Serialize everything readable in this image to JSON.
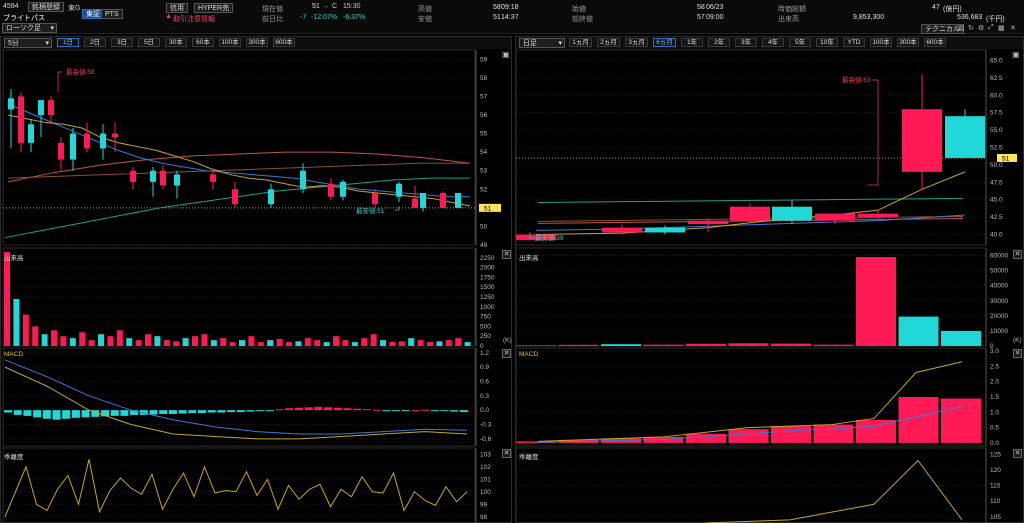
{
  "header": {
    "code": "4594",
    "name": "ブライトパス",
    "register_btn": "銘柄登録",
    "market": "東G",
    "exch_tse": "東証",
    "exch_pts": "PTS",
    "market_select": "ローソク足",
    "credit_badge": "信用",
    "hyper_badge": "HYPER売",
    "warning_text": "取引注意情報",
    "current_label": "現在値",
    "current_value": "51",
    "current_arrow": "→",
    "current_flag": "C",
    "current_time": "15:30",
    "change_label": "前日比",
    "change_value": "-7",
    "change_pct": "-12.07%",
    "change_pct2": "-6.37%",
    "high_label": "高値",
    "high_value": "58",
    "high_time": "09:18",
    "low_label": "安値",
    "low_value": "51",
    "low_time": "14:37",
    "open_label": "始値",
    "open_value": "58",
    "open_date": "06/23",
    "prevclose_label": "前終値",
    "prevclose_value": "57",
    "prevclose_time": "09:00",
    "prevdiff_label": "陽値",
    "mcap_label": "時価総額",
    "mcap_value": "47",
    "mcap_unit": "(億円)",
    "volume_label": "出来高",
    "volume_value": "9,853,300",
    "turnover_value": "536,683",
    "turnover_unit": "(千円)",
    "technical_btn": "テクニカル"
  },
  "left": {
    "interval_select": "5分",
    "tabs": [
      "1日",
      "2日",
      "3日",
      "5日",
      "30本",
      "60本",
      "100本",
      "300本",
      "600本"
    ],
    "active_tab": "1日",
    "price_high_label": "最高値:58",
    "price_low_label": "最安値:51",
    "price_axis": [
      "59",
      "58",
      "57",
      "56",
      "55",
      "54",
      "53",
      "52",
      "51",
      "50",
      "49"
    ],
    "last_price": "51",
    "volume_title": "出来高",
    "volume_axis": [
      "2500",
      "2250",
      "2000",
      "1750",
      "1500",
      "1250",
      "1000",
      "750",
      "500",
      "250",
      "0"
    ],
    "volume_unit": "(K)",
    "macd_title": "MACD",
    "macd_axis": [
      "1.2",
      "0.9",
      "0.6",
      "0.3",
      "0.0",
      "-0.3",
      "-0.6"
    ],
    "kairi_title": "乖離度",
    "kairi_axis": [
      "103",
      "102",
      "101",
      "100",
      "99",
      "98"
    ]
  },
  "right": {
    "interval_select": "日足",
    "tabs": [
      "1ヵ月",
      "2ヵ月",
      "3ヵ月",
      "6ヵ月",
      "1年",
      "2年",
      "3年",
      "4年",
      "5年",
      "10年",
      "YTD",
      "100本",
      "300本",
      "600本"
    ],
    "active_tab": "6ヵ月",
    "price_high_label": "最高値:63",
    "price_low_label": "最安値:39",
    "price_axis": [
      "65.0",
      "62.5",
      "60.0",
      "57.5",
      "55.0",
      "52.5",
      "50.0",
      "47.5",
      "45.0",
      "42.5",
      "40.0"
    ],
    "last_price": "51",
    "volume_title": "出来高",
    "volume_axis": [
      "60000",
      "50000",
      "40000",
      "30000",
      "20000",
      "10000",
      "0"
    ],
    "volume_unit": "(K)",
    "macd_title": "MACD",
    "macd_axis": [
      "3.0",
      "2.5",
      "2.0",
      "1.5",
      "1.0",
      "0.5",
      "0.0"
    ],
    "kairi_title": "乖離度",
    "kairi_axis": [
      "125",
      "120",
      "115",
      "110",
      "105"
    ]
  },
  "chart_data": [
    {
      "type": "candlestick",
      "title": "5分",
      "ylim": [
        49,
        59.5
      ],
      "candles": [
        {
          "o": 56.3,
          "h": 57.4,
          "l": 54.2,
          "c": 56.9,
          "d": "up"
        },
        {
          "o": 57.0,
          "h": 57.2,
          "l": 54.0,
          "c": 54.5,
          "d": "down"
        },
        {
          "o": 54.5,
          "h": 55.8,
          "l": 54.0,
          "c": 55.5,
          "d": "up"
        },
        {
          "o": 56.0,
          "h": 56.8,
          "l": 54.8,
          "c": 56.8,
          "d": "up"
        },
        {
          "o": 56.8,
          "h": 57.0,
          "l": 55.5,
          "c": 56.0,
          "d": "down"
        },
        {
          "o": 54.5,
          "h": 54.8,
          "l": 53.0,
          "c": 53.6,
          "d": "down"
        },
        {
          "o": 53.6,
          "h": 55.3,
          "l": 53.0,
          "c": 55.0,
          "d": "up"
        },
        {
          "o": 55.0,
          "h": 55.6,
          "l": 54.0,
          "c": 54.2,
          "d": "down"
        },
        {
          "o": 54.2,
          "h": 55.5,
          "l": 53.6,
          "c": 55.0,
          "d": "up"
        },
        {
          "o": 55.0,
          "h": 55.6,
          "l": 54.0,
          "c": 54.8,
          "d": "down"
        },
        {
          "o": 53.0,
          "h": 53.2,
          "l": 52.0,
          "c": 52.4,
          "d": "down"
        },
        {
          "o": 52.4,
          "h": 53.2,
          "l": 51.6,
          "c": 53.0,
          "d": "up"
        },
        {
          "o": 53.0,
          "h": 53.3,
          "l": 52.0,
          "c": 52.2,
          "d": "down"
        },
        {
          "o": 52.2,
          "h": 53.0,
          "l": 51.5,
          "c": 52.8,
          "d": "up"
        },
        {
          "o": 52.8,
          "h": 53.0,
          "l": 52.0,
          "c": 52.4,
          "d": "down"
        },
        {
          "o": 52.0,
          "h": 52.4,
          "l": 51.0,
          "c": 51.2,
          "d": "down"
        },
        {
          "o": 51.2,
          "h": 52.3,
          "l": 51.0,
          "c": 52.0,
          "d": "up"
        },
        {
          "o": 52.0,
          "h": 53.4,
          "l": 51.8,
          "c": 53.0,
          "d": "up"
        },
        {
          "o": 52.3,
          "h": 52.6,
          "l": 51.4,
          "c": 51.6,
          "d": "down"
        },
        {
          "o": 51.6,
          "h": 52.5,
          "l": 51.4,
          "c": 52.4,
          "d": "up"
        },
        {
          "o": 51.8,
          "h": 52.0,
          "l": 51.0,
          "c": 51.2,
          "d": "down"
        },
        {
          "o": 51.6,
          "h": 52.4,
          "l": 51.3,
          "c": 52.3,
          "d": "up"
        },
        {
          "o": 51.5,
          "h": 52.2,
          "l": 51.0,
          "c": 51.0,
          "d": "down"
        },
        {
          "o": 51.0,
          "h": 51.8,
          "l": 50.8,
          "c": 51.8,
          "d": "up"
        },
        {
          "o": 51.8,
          "h": 51.9,
          "l": 51.0,
          "c": 51.0,
          "d": "down"
        },
        {
          "o": 51.0,
          "h": 51.8,
          "l": 51.0,
          "c": 51.8,
          "d": "up"
        }
      ],
      "ma_short": [
        56.0,
        55.8,
        55.6,
        55.5,
        55.3,
        54.8,
        54.5,
        54.3,
        54.1,
        53.8,
        53.5,
        53.1,
        52.8,
        52.6,
        52.5,
        52.3,
        52.1,
        52.2,
        52.1,
        51.9,
        51.8,
        51.7,
        51.6,
        51.5,
        51.3,
        51.1
      ],
      "ma_mid": [
        56.6,
        56.1,
        55.6,
        55.1,
        54.6,
        54.1,
        53.7,
        53.4,
        53.2,
        53.0,
        52.9,
        52.8,
        52.7,
        52.6,
        52.4,
        52.2,
        52.0,
        51.9,
        51.8,
        51.7,
        51.6,
        51.6
      ],
      "ma_long1": [
        52.4,
        52.9,
        53.3,
        53.6,
        53.8,
        53.9,
        54.0,
        54.0,
        53.9,
        53.7,
        53.4
      ],
      "ma_long2": [
        52.6,
        52.7,
        52.8,
        52.9,
        53.0,
        53.1,
        53.2,
        53.3,
        53.4,
        53.4
      ],
      "ma_rising": [
        49.4,
        49.8,
        50.2,
        50.6,
        51.0,
        51.3,
        51.6,
        51.9,
        52.1,
        52.3,
        52.5,
        52.6,
        52.6
      ],
      "last": 51
    },
    {
      "type": "candlestick",
      "title": "日足",
      "ylim": [
        38.5,
        66.5
      ],
      "candles": [
        {
          "o": 40.0,
          "h": 40.2,
          "l": 39.0,
          "c": 39.2,
          "d": "down"
        },
        {
          "o": 41.0,
          "h": 41.4,
          "l": 40.0,
          "c": 40.3,
          "d": "down"
        },
        {
          "o": 40.3,
          "h": 41.3,
          "l": 40.0,
          "c": 41.0,
          "d": "up"
        },
        {
          "o": 41.5,
          "h": 42.3,
          "l": 40.4,
          "c": 42.0,
          "d": "down"
        },
        {
          "o": 42.0,
          "h": 44.5,
          "l": 41.8,
          "c": 44.0,
          "d": "down"
        },
        {
          "o": 42.0,
          "h": 45.0,
          "l": 41.5,
          "c": 44.0,
          "d": "up"
        },
        {
          "o": 42.0,
          "h": 43.0,
          "l": 41.5,
          "c": 43.0,
          "d": "down"
        },
        {
          "o": 43.0,
          "h": 43.5,
          "l": 42.0,
          "c": 42.5,
          "d": "down"
        },
        {
          "o": 49.0,
          "h": 63.0,
          "l": 46.5,
          "c": 58.0,
          "d": "down"
        },
        {
          "o": 51.0,
          "h": 58.0,
          "l": 51.0,
          "c": 57.0,
          "d": "up"
        }
      ],
      "ma_yellow": [
        40.0,
        40.2,
        40.6,
        41.0,
        41.7,
        42.3,
        42.8,
        43.5,
        46.5,
        49.0
      ],
      "ma_blue": [
        40.6,
        40.8,
        41.0,
        41.2,
        41.4,
        41.6,
        41.8,
        42.0,
        42.4,
        42.8
      ],
      "last": 51
    },
    {
      "type": "bar",
      "title": "出来高 (5分)",
      "ylim": [
        0,
        2500
      ],
      "values": [
        2400,
        1200,
        800,
        500,
        300,
        400,
        250,
        200,
        350,
        150,
        300,
        250,
        400,
        200,
        150,
        300,
        250,
        150,
        120,
        200,
        250,
        300,
        150,
        200,
        100,
        150,
        250,
        100,
        150,
        180,
        100,
        120,
        200,
        150,
        100,
        250,
        150,
        100,
        200,
        300,
        150,
        100,
        120,
        200,
        150,
        100,
        120,
        150,
        200,
        100
      ]
    },
    {
      "type": "bar",
      "title": "出来高 (日足)",
      "ylim": [
        0,
        65000
      ],
      "values": [
        500,
        800,
        1200,
        900,
        1500,
        1800,
        1600,
        900,
        59000,
        19500,
        10000
      ]
    },
    {
      "type": "bar",
      "title": "MACD (5分)",
      "ylim": [
        -0.75,
        1.3
      ],
      "values": [
        -0.05,
        -0.1,
        -0.12,
        -0.15,
        -0.18,
        -0.2,
        -0.18,
        -0.16,
        -0.15,
        -0.14,
        -0.13,
        -0.12,
        -0.12,
        -0.1,
        -0.1,
        -0.09,
        -0.08,
        -0.08,
        -0.07,
        -0.06,
        -0.06,
        -0.05,
        -0.05,
        -0.04,
        -0.04,
        -0.03,
        -0.02,
        -0.01,
        0.02,
        0.04,
        0.05,
        0.06,
        0.07,
        0.06,
        0.05,
        0.04,
        0.03,
        0.02,
        0.01,
        -0.01,
        -0.02,
        -0.01,
        0.0,
        0.01,
        -0.01,
        -0.02,
        -0.03,
        -0.04
      ]
    },
    {
      "type": "bar",
      "title": "MACD (日足)",
      "ylim": [
        -0.1,
        3.1
      ],
      "values": [
        0.05,
        0.1,
        0.15,
        0.2,
        0.3,
        0.45,
        0.55,
        0.6,
        0.75,
        1.5,
        1.45
      ]
    }
  ]
}
